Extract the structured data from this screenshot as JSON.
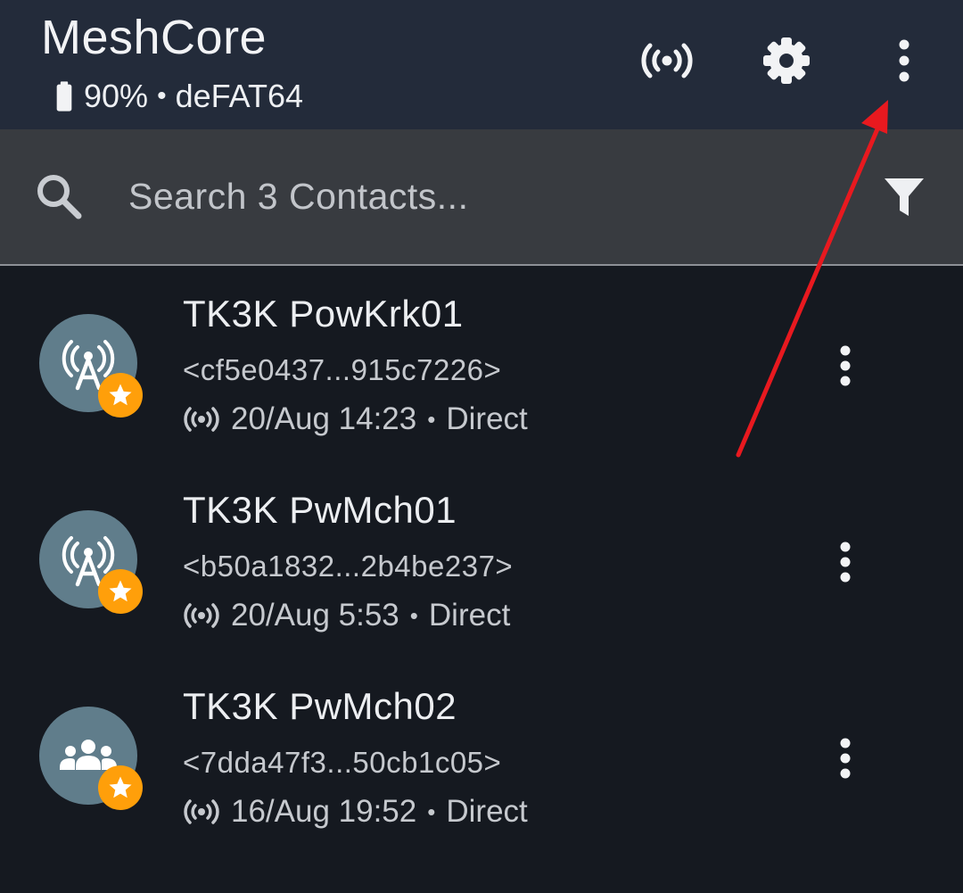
{
  "appbar": {
    "title": "MeshCore",
    "battery_percent": "90%",
    "separator": "•",
    "device_name": "deFAT64",
    "icons": {
      "battery": "battery-icon",
      "radio": "radio-signal-icon",
      "settings": "gear-icon",
      "more": "more-vert-icon"
    }
  },
  "search": {
    "placeholder": "Search 3 Contacts...",
    "value": "",
    "icons": {
      "search": "search-icon",
      "filter": "filter-icon"
    }
  },
  "contacts": [
    {
      "name": "TK3K PowKrk01",
      "key": "<cf5e0437...915c7226>",
      "last_heard": "20/Aug 14:23",
      "sep": "•",
      "route": "Direct",
      "type_icon": "repeater-antenna-icon",
      "favorite": true
    },
    {
      "name": "TK3K PwMch01",
      "key": "<b50a1832...2b4be237>",
      "last_heard": "20/Aug 5:53",
      "sep": "•",
      "route": "Direct",
      "type_icon": "repeater-antenna-icon",
      "favorite": true
    },
    {
      "name": "TK3K PwMch02",
      "key": "<7dda47f3...50cb1c05>",
      "last_heard": "16/Aug 19:52",
      "sep": "•",
      "route": "Direct",
      "type_icon": "group-icon",
      "favorite": true
    }
  ],
  "colors": {
    "appbar_bg": "#232b3a",
    "search_bg": "#383b40",
    "list_bg": "#151920",
    "avatar_bg": "#607d8b",
    "favorite_badge": "#ff9f0a",
    "annotation_arrow": "#e8191f"
  }
}
